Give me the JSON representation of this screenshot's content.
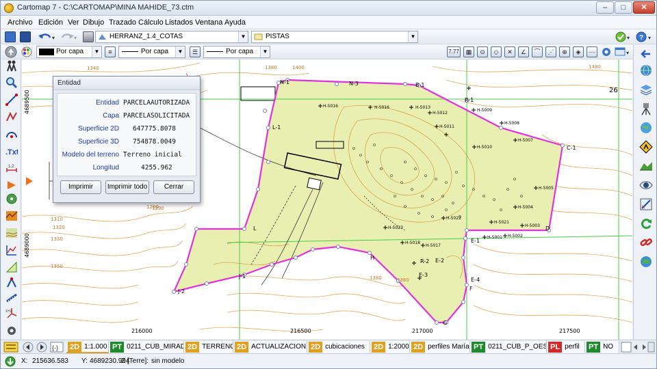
{
  "window": {
    "title": "Cartomap 7 - C:\\CARTOMAP\\MINA MAHIDE_73.ctm",
    "controls": {
      "minimize": "–",
      "maximize": "□",
      "close": "✕"
    }
  },
  "menu": [
    "Archivo",
    "Edición",
    "Ver",
    "Dibujo",
    "Trazado",
    "Cálculo",
    "Listados",
    "Ventana",
    "Ayuda"
  ],
  "toolbar1": {
    "layer_combo": "HERRANZ_1.4_COTAS",
    "layer2_combo": "PISTAS"
  },
  "toolbar2": {
    "color_combo": "Por capa",
    "linetype_combo": "Por capa",
    "lineweight_combo": "Por capa",
    "scale_value": "7.77"
  },
  "dialog": {
    "title": "Entidad",
    "fields": [
      {
        "label": "Entidad",
        "value": "PARCELAAUTORIZADA"
      },
      {
        "label": "Capa",
        "value": "PARCELASOLICITADA"
      },
      {
        "label": "Superficie 2D",
        "value": "647775.8078"
      },
      {
        "label": "Superficie 3D",
        "value": "754878.0049"
      },
      {
        "label": "Modelo del terreno",
        "value": "Terreno inicial"
      },
      {
        "label": "Longitud",
        "value": "4255.962"
      }
    ],
    "buttons": {
      "print": "Imprimir",
      "print_all": "Imprimir todo",
      "close": "Cerrar"
    }
  },
  "map": {
    "axis_y_labels": [
      "4689500",
      "4689000"
    ],
    "axis_x_labels": [
      "216000",
      "216500",
      "217000",
      "217500"
    ],
    "vertex_labels": [
      "N-1",
      "N-3",
      "B-1",
      "C-1",
      "L-1",
      "L",
      "D",
      "E-1",
      "E-2",
      "E-3",
      "E-4",
      "F",
      "G",
      "H",
      "J-1",
      "J-2",
      "R-1",
      "R-2"
    ],
    "contour_labels": [
      "1340",
      "1380",
      "1400",
      "1320",
      "1300",
      "1290",
      "1280",
      "1310",
      "1330",
      "1350",
      "1360",
      "1380",
      "1490",
      "26"
    ],
    "point_labels": [
      "H-5016",
      "H-5016",
      "H-5013",
      "H-5012",
      "H-5011",
      "H-5009",
      "H-5008",
      "H-5007",
      "H-5010",
      "H-5005",
      "H-5004",
      "H-5003",
      "H-5002",
      "H-5001",
      "H-5017",
      "H-5018",
      "H-5021",
      "H-5022",
      "H-5023"
    ]
  },
  "tabs": [
    {
      "badge": "2D",
      "kind": "2d",
      "label": "1:1.000"
    },
    {
      "badge": "PT",
      "kind": "pt",
      "label": "0211_CUB_MIRADC"
    },
    {
      "badge": "2D",
      "kind": "2d",
      "label": "TERRENO"
    },
    {
      "badge": "2D",
      "kind": "2d",
      "label": "ACTUALIZACION"
    },
    {
      "badge": "2D",
      "kind": "2d",
      "label": "cubicaciones"
    },
    {
      "badge": "2D",
      "kind": "2d",
      "label": "1:2000"
    },
    {
      "badge": "2D",
      "kind": "2d",
      "label": "perfiles María"
    },
    {
      "badge": "PT",
      "kind": "pt",
      "label": "0211_CUB_P_OESTE"
    },
    {
      "badge": "PL",
      "kind": "pl",
      "label": "perfil"
    },
    {
      "badge": "PT",
      "kind": "pt",
      "label": "NO"
    }
  ],
  "status": {
    "x_label": "X:",
    "x_value": "215636.583",
    "y_label": "Y:",
    "y_value": "4689230.994",
    "z_label": "Z [Terre]:",
    "z_value": "sin modelo"
  },
  "colors": {
    "terrain_fill": "#e9efb0",
    "contour": "#e0a050",
    "parcel": "#e030e0",
    "grid": "#44cc44"
  }
}
